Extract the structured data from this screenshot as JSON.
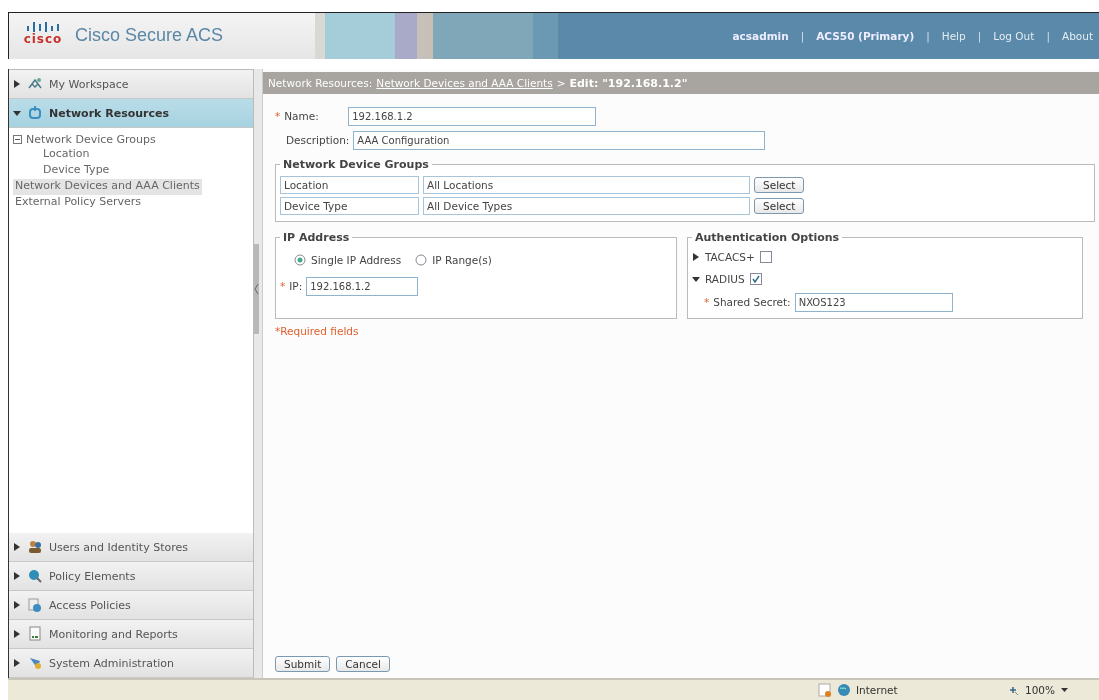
{
  "header": {
    "logo": "cisco",
    "title": "Cisco Secure ACS",
    "links": [
      {
        "label": "acsadmin",
        "kind": "user"
      },
      {
        "label": "ACS50 (Primary)",
        "kind": "user"
      },
      {
        "label": "Help",
        "kind": "link"
      },
      {
        "label": "Log Out",
        "kind": "link"
      },
      {
        "label": "About",
        "kind": "link"
      }
    ],
    "separator": "|"
  },
  "sidebar": {
    "drawers": [
      {
        "label": "My Workspace",
        "expanded": false
      },
      {
        "label": "Network Resources",
        "expanded": true,
        "tree": [
          {
            "label": "Network Device Groups",
            "expanded": true,
            "selected": false,
            "children": [
              {
                "label": "Location",
                "selected": false
              },
              {
                "label": "Device Type",
                "selected": false
              }
            ]
          },
          {
            "label": "Network Devices and AAA Clients",
            "selected": true
          },
          {
            "label": "External Policy Servers",
            "selected": false
          }
        ]
      },
      {
        "label": "Users and Identity Stores",
        "expanded": false
      },
      {
        "label": "Policy Elements",
        "expanded": false
      },
      {
        "label": "Access Policies",
        "expanded": false
      },
      {
        "label": "Monitoring and Reports",
        "expanded": false
      },
      {
        "label": "System Administration",
        "expanded": false
      }
    ]
  },
  "content": {
    "breadcrumb": {
      "prefix": "Network Resources:",
      "link": "Network Devices and AAA Clients",
      "separator": ">",
      "current": "Edit: \"192.168.1.2\""
    },
    "required_mark": "*",
    "name": {
      "label": "Name:",
      "required": true,
      "value": "192.168.1.2"
    },
    "description": {
      "label": "Description:",
      "value": "AAA Configuration"
    },
    "device_groups": {
      "legend": "Network Device Groups",
      "rows": [
        {
          "label": "Location",
          "value": "All Locations",
          "button": "Select"
        },
        {
          "label": "Device Type",
          "value": "All Device Types",
          "button": "Select"
        }
      ]
    },
    "ip_address": {
      "legend": "IP Address",
      "radios": [
        {
          "label": "Single IP Address",
          "selected": true
        },
        {
          "label": "IP Range(s)",
          "selected": false
        }
      ],
      "ip": {
        "label": "IP:",
        "required": true,
        "value": "192.168.1.2"
      }
    },
    "authentication": {
      "legend": "Authentication Options",
      "protocols": [
        {
          "label": "TACACS+",
          "expanded": false,
          "checked": false
        },
        {
          "label": "RADIUS",
          "expanded": true,
          "checked": true,
          "fields": [
            {
              "label": "Shared Secret:",
              "required": true,
              "value": "NXOS123"
            }
          ]
        }
      ]
    },
    "required_note": "Required fields",
    "buttons": [
      "Submit",
      "Cancel"
    ]
  },
  "status_bar": {
    "zone": "Internet",
    "zoom": "100%"
  }
}
